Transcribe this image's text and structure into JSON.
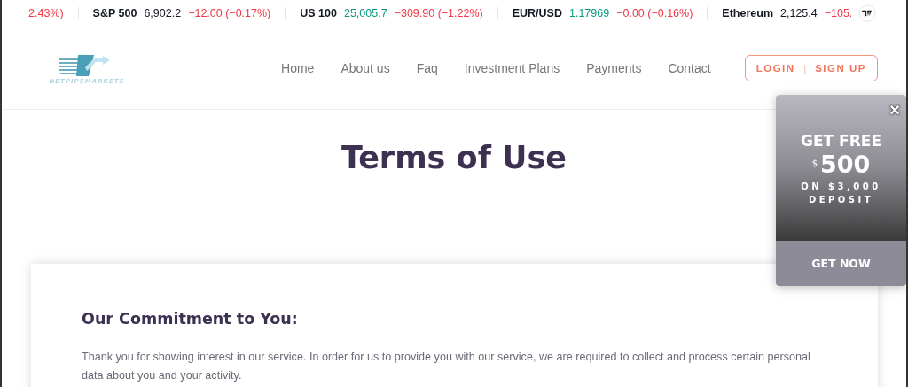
{
  "ticker": [
    {
      "change": {
        "text": "2.43%)",
        "color": "#f23645"
      }
    },
    {
      "symbol": "S&P 500",
      "price": {
        "text": "6,902.2"
      },
      "change": {
        "text": "−12.00 (−0.17%)",
        "color": "#f23645"
      }
    },
    {
      "symbol": "US 100",
      "price": {
        "text": "25,005.7",
        "color": "#089981"
      },
      "change": {
        "text": "−309.90 (−1.22%)",
        "color": "#f23645"
      }
    },
    {
      "symbol": "EUR/USD",
      "price": {
        "text": "1.17969",
        "color": "#089981"
      },
      "change": {
        "text": "−0.00 (−0.16%)",
        "color": "#f23645"
      }
    },
    {
      "symbol": "Ethereum",
      "price": {
        "text": "2,125.4"
      },
      "change": {
        "text": "−105.",
        "color": "#f23645"
      }
    }
  ],
  "logo": {
    "text": "NETPIPSMARKETS"
  },
  "nav": [
    {
      "label": "Home"
    },
    {
      "label": "About us"
    },
    {
      "label": "Faq"
    },
    {
      "label": "Investment Plans"
    },
    {
      "label": "Payments"
    },
    {
      "label": "Contact"
    }
  ],
  "auth": {
    "login": "LOGIN",
    "separator": "|",
    "signup": "SIGN UP"
  },
  "page_title": "Terms of Use",
  "section": {
    "heading": "Our Commitment to You:",
    "text": "Thank you for showing interest in our service. In order for us to provide you with our service, we are required to collect and process certain personal data about you and your activity."
  },
  "promo": {
    "close": "×",
    "headline": "GET FREE",
    "currency": "$",
    "amount": "500",
    "line1": "ON $3,000",
    "line2": "DEPOSIT",
    "button": "GET NOW"
  }
}
